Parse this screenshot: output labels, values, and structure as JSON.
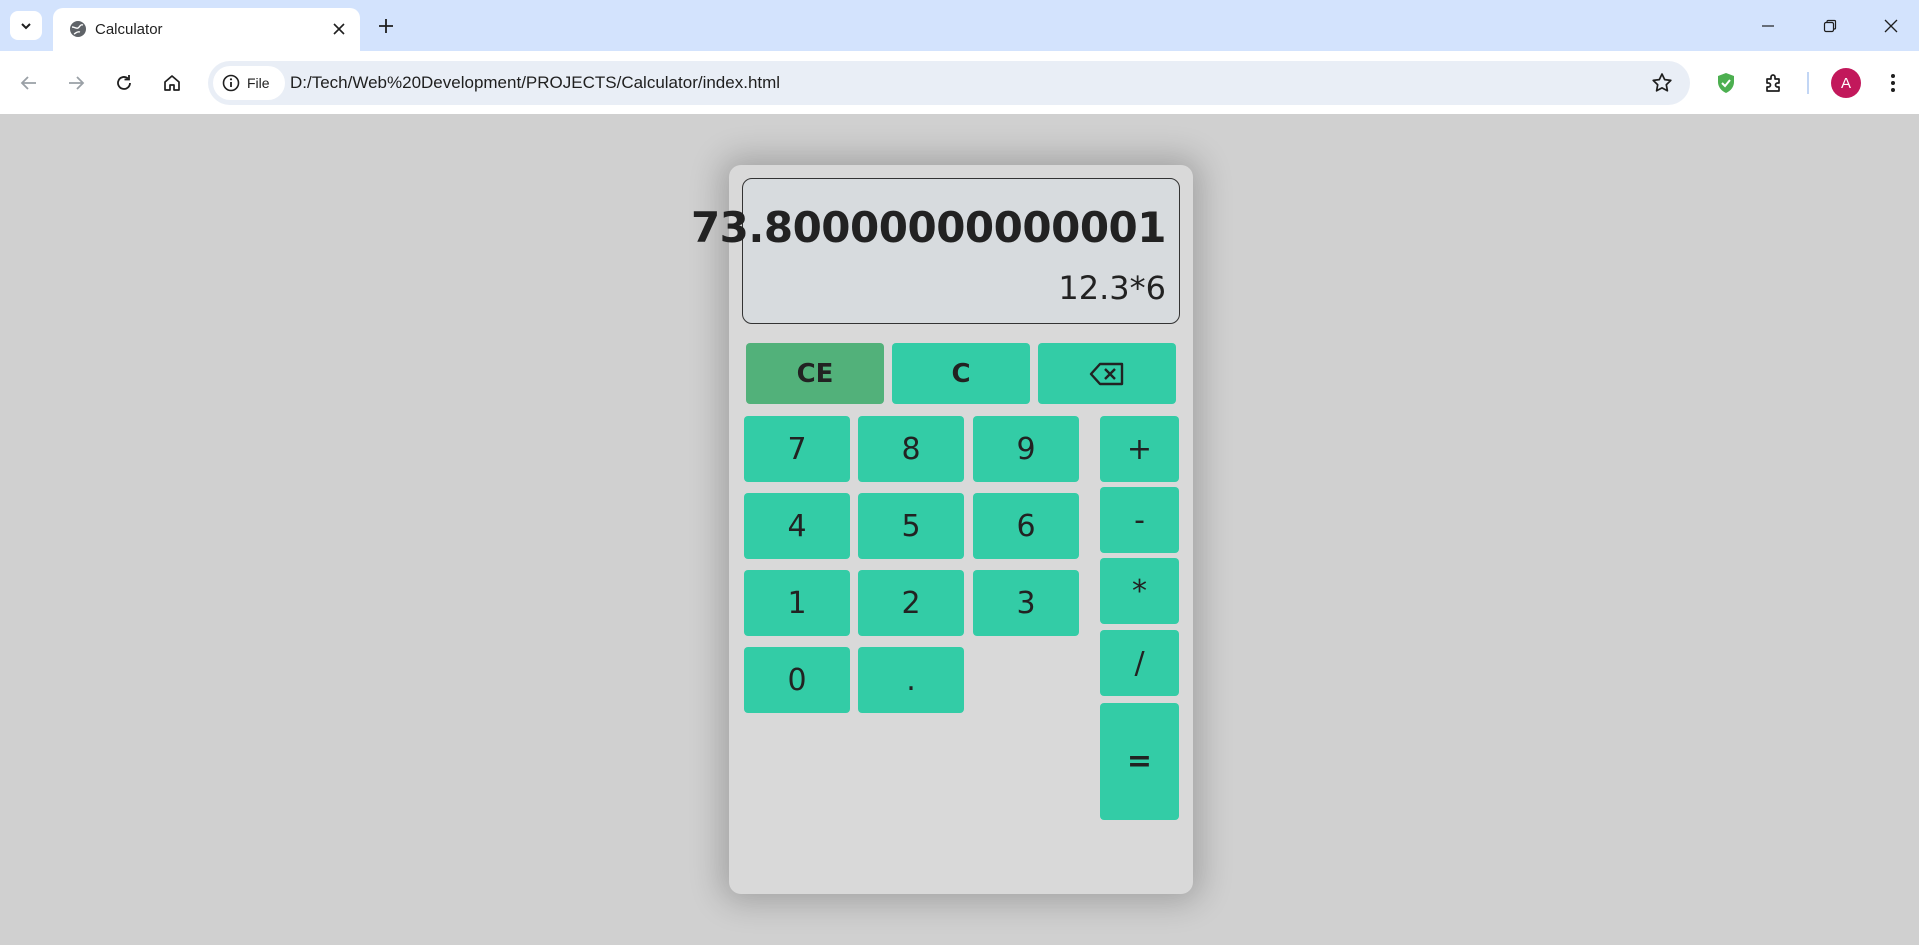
{
  "browser": {
    "tab_title": "Calculator",
    "site_info_label": "File",
    "url": "D:/Tech/Web%20Development/PROJECTS/Calculator/index.html",
    "profile_initial": "A"
  },
  "calculator": {
    "result": "73.80000000000001",
    "expression": "12.3*6",
    "keys": {
      "ce": "CE",
      "clear": "C",
      "seven": "7",
      "eight": "8",
      "nine": "9",
      "four": "4",
      "five": "5",
      "six": "6",
      "one": "1",
      "two": "2",
      "three": "3",
      "zero": "0",
      "dot": ".",
      "plus": "+",
      "minus": "-",
      "multiply": "*",
      "divide": "/",
      "equals": "="
    }
  },
  "colors": {
    "key": "#33cca6",
    "ce_key": "#52b17a",
    "page_background": "#d0d0d0",
    "calc_body": "#d9d9d9"
  },
  "icons": [
    "tab-search-icon",
    "globe-icon",
    "close-icon",
    "plus-icon",
    "minimize-icon",
    "restore-icon",
    "back-icon",
    "forward-icon",
    "reload-icon",
    "home-icon",
    "info-icon",
    "star-icon",
    "shield-check-icon",
    "extensions-icon",
    "more-icon",
    "backspace-icon"
  ]
}
